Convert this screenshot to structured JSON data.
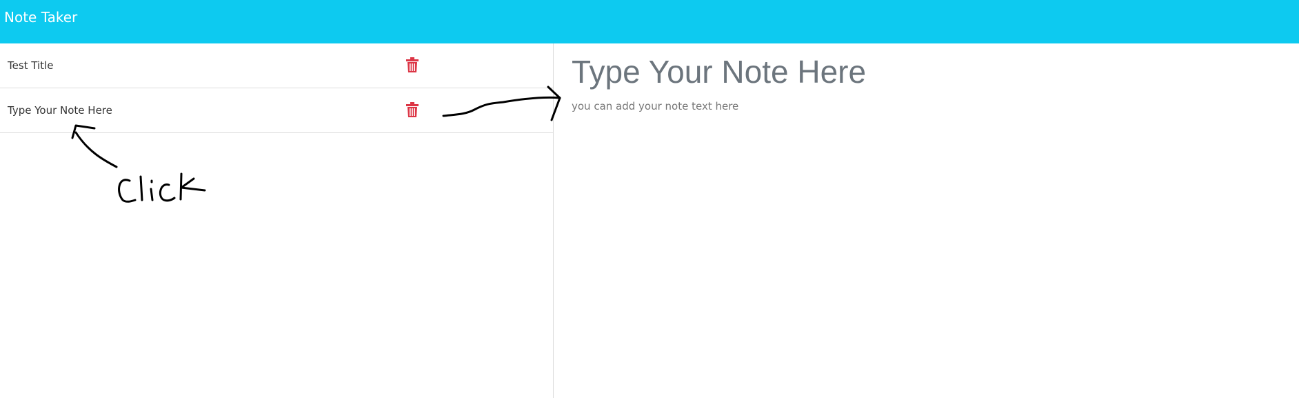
{
  "app": {
    "brand": "Note Taker",
    "brand_color": "#0dcaf0",
    "delete_color": "#dc3545"
  },
  "notes": [
    {
      "title": "Test Title",
      "delete_icon": "trash-icon"
    },
    {
      "title": "Type Your Note Here",
      "delete_icon": "trash-icon"
    }
  ],
  "editor": {
    "title_placeholder": "Type Your Note Here",
    "text_placeholder": "you can add your note text here"
  },
  "annotation": {
    "handwritten_text": "click"
  }
}
